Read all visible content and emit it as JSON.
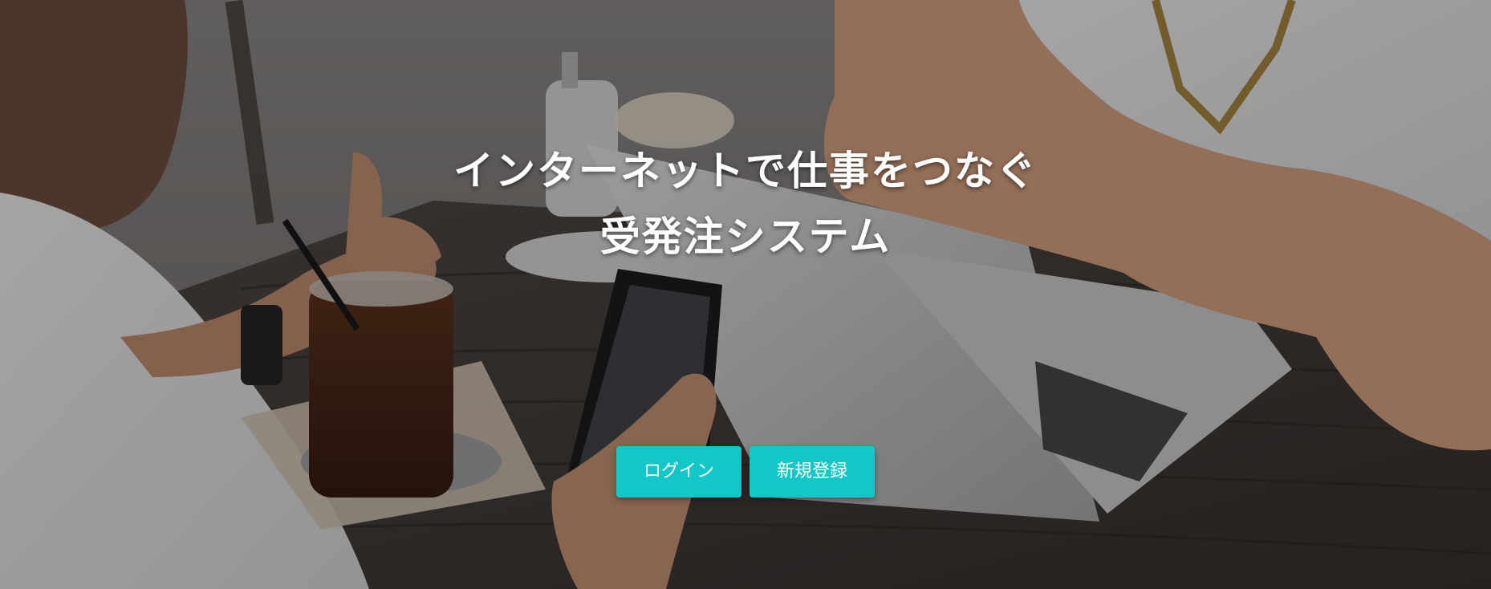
{
  "hero": {
    "title_line1": "インターネットで仕事をつなぐ",
    "title_line2": "受発注システム",
    "background": "cafe-meeting-photo"
  },
  "actions": {
    "login_label": "ログイン",
    "register_label": "新規登録"
  },
  "colors": {
    "accent": "#13c6c7",
    "text": "#ffffff"
  }
}
